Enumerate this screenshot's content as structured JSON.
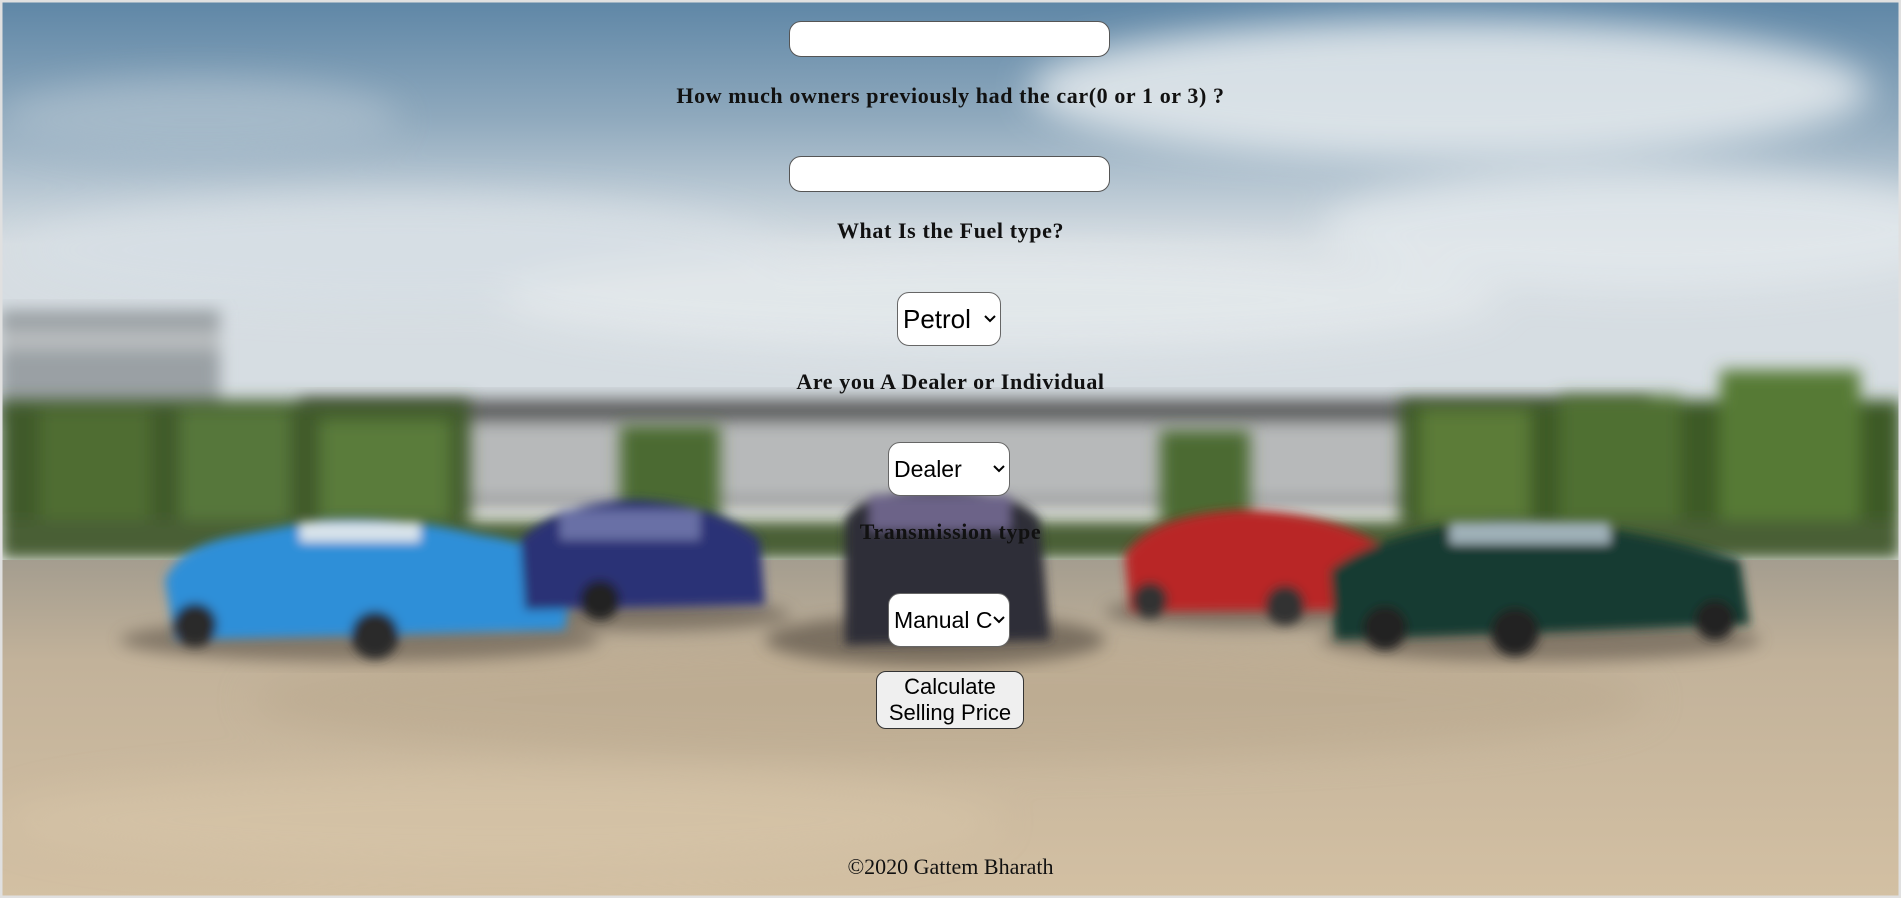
{
  "form": {
    "owners_input": {
      "value": "",
      "placeholder": ""
    },
    "year_input": {
      "value": "",
      "placeholder": ""
    },
    "owners_question": "How much owners previously had the car(0 or 1 or 3) ?",
    "fuel_question": "What Is the Fuel type?",
    "fuel_select": {
      "selected": "Petrol"
    },
    "seller_question": "Are you A Dealer or Individual",
    "seller_select": {
      "selected": "Dealer"
    },
    "transmission_question": "Transmission type",
    "transmission_select": {
      "selected": "Manual C"
    },
    "submit_label_line1": "Calculate",
    "submit_label_line2": "Selling Price"
  },
  "footer": {
    "copyright": "©2020 Gattem Bharath"
  },
  "icons": {
    "select_chevron": "chevron-down-icon"
  },
  "background": {
    "description_semantic": "blurred-car-lineup-photo"
  }
}
